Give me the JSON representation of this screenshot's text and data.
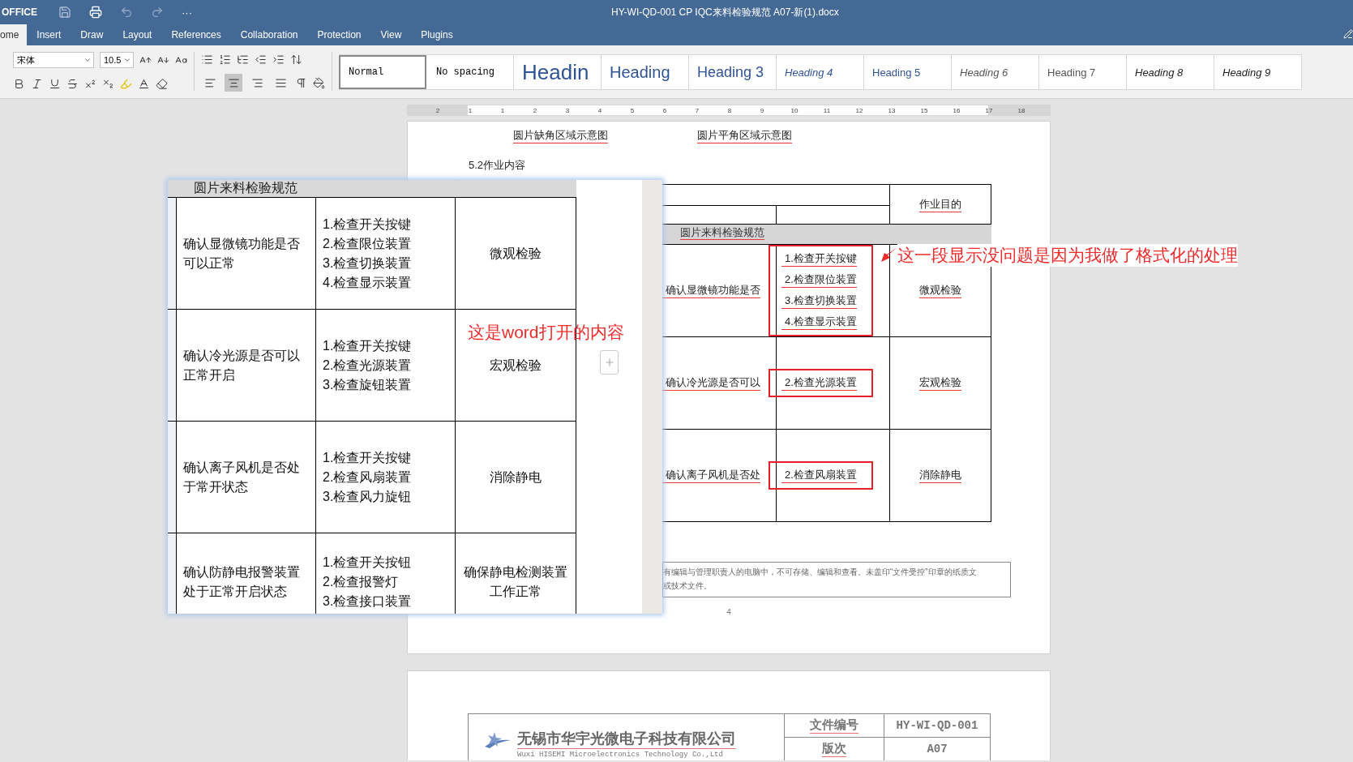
{
  "app": {
    "brand": "OFFICE",
    "more": "···",
    "title": "HY-WI-QD-001 CP  IQC来料检验规范 A07-新(1).docx"
  },
  "tabs": [
    {
      "label": "ome",
      "selected": true
    },
    {
      "label": "Insert",
      "selected": false
    },
    {
      "label": "Draw",
      "selected": false
    },
    {
      "label": "Layout",
      "selected": false
    },
    {
      "label": "References",
      "selected": false
    },
    {
      "label": "Collaboration",
      "selected": false
    },
    {
      "label": "Protection",
      "selected": false
    },
    {
      "label": "View",
      "selected": false
    },
    {
      "label": "Plugins",
      "selected": false
    }
  ],
  "toolbar": {
    "font": "宋体",
    "size": "10.5",
    "align": [
      {
        "selected": false
      },
      {
        "selected": true
      },
      {
        "selected": false
      },
      {
        "selected": false
      }
    ]
  },
  "styles": [
    {
      "label": "Normal",
      "kind": "normal",
      "selected": true
    },
    {
      "label": "No spacing",
      "kind": "normal",
      "selected": false
    },
    {
      "label": "Headin",
      "kind": "h1",
      "selected": false
    },
    {
      "label": "Heading",
      "kind": "h2",
      "selected": false
    },
    {
      "label": "Heading 3",
      "kind": "h3",
      "selected": false
    },
    {
      "label": "Heading 4",
      "kind": "h4",
      "selected": false
    },
    {
      "label": "Heading 5",
      "kind": "h5",
      "selected": false
    },
    {
      "label": "Heading 6",
      "kind": "h6",
      "selected": false
    },
    {
      "label": "Heading 7",
      "kind": "h7",
      "selected": false
    },
    {
      "label": "Heading 8",
      "kind": "h8",
      "selected": false
    },
    {
      "label": "Heading 9",
      "kind": "h9",
      "selected": false
    }
  ],
  "ruler": [
    "2",
    "1",
    "1",
    "2",
    "3",
    "4",
    "5",
    "6",
    "7",
    "8",
    "9",
    "10",
    "11",
    "12",
    "13",
    "15",
    "16",
    "17",
    "18"
  ],
  "page": {
    "captions": [
      "圆片缺角区域示意图",
      "圆片平角区域示意图"
    ],
    "section": "5.2作业内容",
    "table": {
      "purpose_header": "作业目的",
      "band": "圆片来料检验规范",
      "rows": [
        {
          "item": "确认显微镜功能是否",
          "checks": [
            "1.检查开关按键",
            "2.检查限位装置",
            "3.检查切换装置",
            "4.检查显示装置"
          ],
          "purpose": "微观检验"
        },
        {
          "item": "确认冷光源是否可以",
          "checks": [
            "2.检查光源装置"
          ],
          "purpose": "宏观检验"
        },
        {
          "item": "确认离子风机是否处",
          "checks": [
            "2.检查风扇装置"
          ],
          "purpose": "消除静电"
        }
      ]
    },
    "notice": [
      "有编辑与管理职责人的电脑中，不可存储、编辑和查看。未盖印“文件受控”印章的纸质文",
      "或技术文件。"
    ],
    "page_number": "4"
  },
  "page2": {
    "company": "无锡市华宇光微电子科技有限公司",
    "company_en": "Wuxi HISEMI Microelectronics Technology Co.,Ltd",
    "fields": [
      {
        "label": "文件编号",
        "value": "HY-WI-QD-001"
      },
      {
        "label": "版次",
        "value": "A07"
      }
    ]
  },
  "overlay": {
    "band": "圆片来料检验规范",
    "rows": [
      {
        "item": "确认显微镜功能是否可以正常",
        "checks": [
          "1.检查开关按键",
          "2.检查限位装置",
          "3.检查切换装置",
          "4.检查显示装置"
        ],
        "purpose": "微观检验"
      },
      {
        "item": "确认冷光源是否可以正常开启",
        "checks": [
          "1.检查开关按键",
          "2.检查光源装置",
          "3.检查旋钮装置"
        ],
        "purpose": "宏观检验"
      },
      {
        "item": "确认离子风机是否处于常开状态",
        "checks": [
          "1.检查开关按键",
          "2.检查风扇装置",
          "3.检查风力旋钮"
        ],
        "purpose": "消除静电"
      },
      {
        "item": "确认防静电报警装置处于正常开启状态",
        "checks": [
          "1.检查开关按钮",
          "2.检查报警灯",
          "3.检查接口装置"
        ],
        "purpose": "确保静电检测装置工作正常"
      }
    ]
  },
  "annotations": [
    {
      "text": "这是word打开的内容"
    },
    {
      "text": "这一段显示没问题是因为我做了格式化的处理"
    }
  ]
}
